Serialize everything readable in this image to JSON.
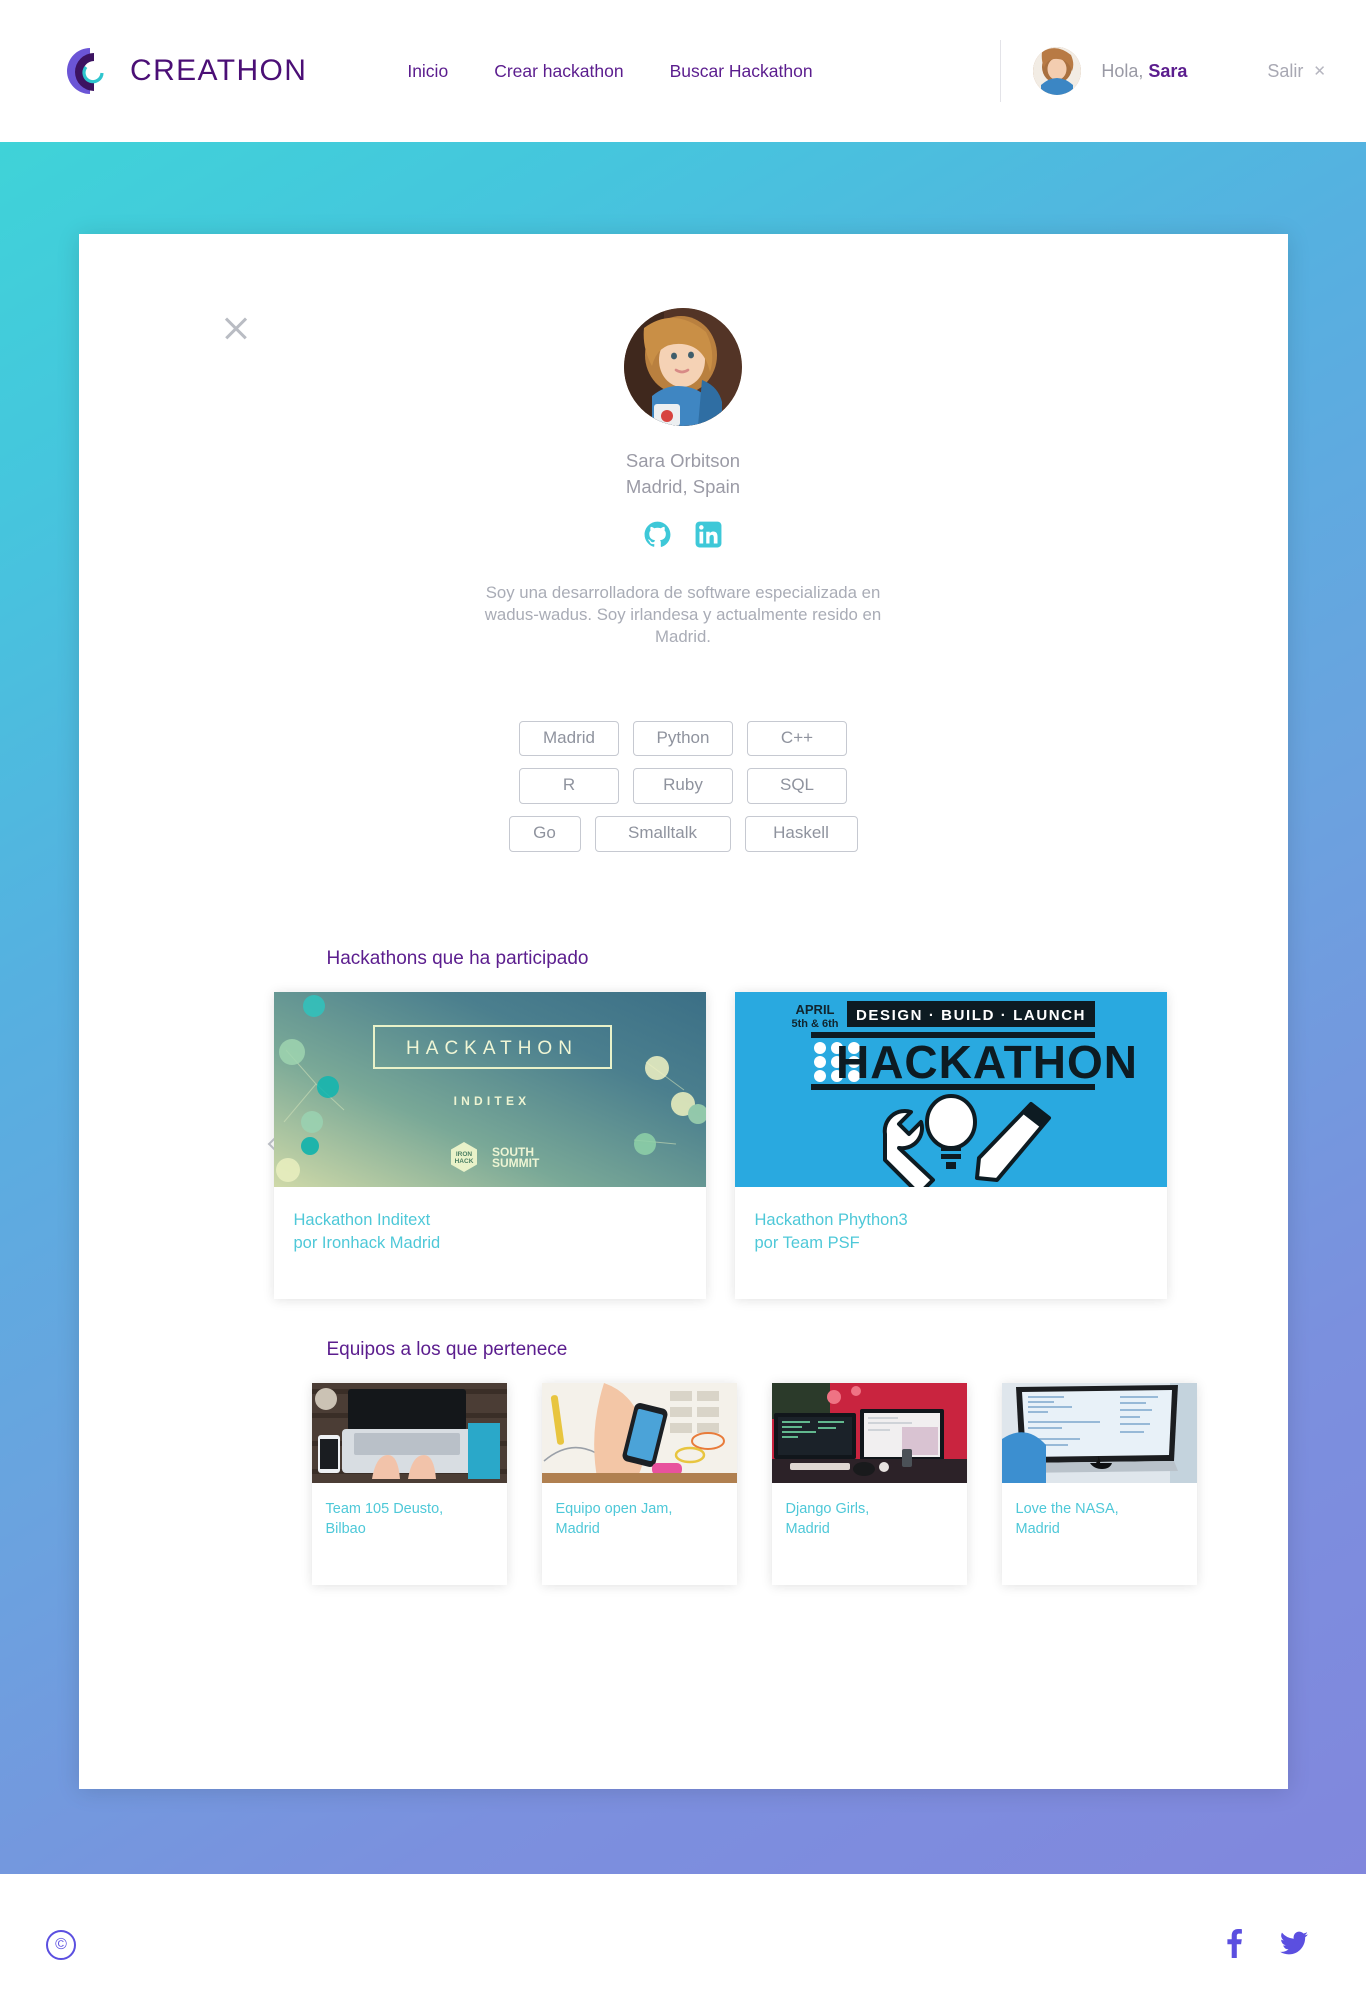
{
  "header": {
    "brand_name": "CREATHON",
    "brand_logo_icon": "creathon-c-logo-icon",
    "nav": [
      {
        "label": "Inicio",
        "name": "nav-inicio"
      },
      {
        "label": "Crear hackathon",
        "name": "nav-crear-hackathon"
      },
      {
        "label": "Buscar Hackathon",
        "name": "nav-buscar-hackathon"
      }
    ],
    "greeting_prefix": "Hola, ",
    "user_name": "Sara",
    "logout_label": "Salir",
    "logout_icon": "close-x-icon",
    "avatar_icon": "user-avatar"
  },
  "modal": {
    "close_icon": "close-icon",
    "profile": {
      "photo_icon": "profile-photo",
      "name": "Sara Orbitson",
      "location": "Madrid, Spain",
      "socials": [
        {
          "name": "github-icon",
          "label": "GitHub",
          "color": "#3ec8d8"
        },
        {
          "name": "linkedin-icon",
          "label": "LinkedIn",
          "color": "#3ec8d8"
        }
      ],
      "bio": "Soy una desarrolladora de software especializada en wadus-wadus. Soy irlandesa y actualmente resido en Madrid."
    },
    "tags": [
      {
        "label": "Madrid",
        "size": "w-md"
      },
      {
        "label": "Python",
        "size": "w-md"
      },
      {
        "label": "C++",
        "size": "w-md"
      },
      {
        "label": "R",
        "size": "w-md"
      },
      {
        "label": "Ruby",
        "size": "w-md"
      },
      {
        "label": "SQL",
        "size": "w-md"
      },
      {
        "label": "Go",
        "size": "w-sm"
      },
      {
        "label": "Smalltalk",
        "size": "w-xl"
      },
      {
        "label": "Haskell",
        "size": "w-lg"
      }
    ],
    "hackathons_section": {
      "title": "Hackathons que ha participado",
      "prev_icon": "chevron-left-icon",
      "next_icon": "chevron-right-icon",
      "cards": [
        {
          "title": "Hackathon Inditext",
          "subtitle": "por Ironhack Madrid",
          "banner_name": "hackathon-inditex-banner",
          "banner_text_main": "HACKATHON",
          "banner_text_sub": "INDITEX",
          "banner_logo_a": "IRON HACK",
          "banner_logo_b": "SOUTH SUMMIT"
        },
        {
          "title": "Hackathon Phython3",
          "subtitle": "por Team PSF",
          "banner_name": "hackathon-python3-banner",
          "banner_date": "APRIL 5th & 6th",
          "banner_tagline": "DESIGN · BUILD · LAUNCH",
          "banner_text_main": "HACKATHON"
        }
      ]
    },
    "teams_section": {
      "title": "Equipos a los que pertenece",
      "cards": [
        {
          "line1": "Team 105 Deusto,",
          "line2": "Bilbao",
          "photo_name": "team-photo-laptop-hands"
        },
        {
          "line1": "Equipo open Jam,",
          "line2": "Madrid",
          "photo_name": "team-photo-sketches-phone"
        },
        {
          "line1": "Django Girls,",
          "line2": "Madrid",
          "photo_name": "team-photo-dual-monitors"
        },
        {
          "line1": "Love the NASA,",
          "line2": "Madrid",
          "photo_name": "team-photo-imac-code"
        }
      ]
    }
  },
  "footer": {
    "copyright_symbol": "©",
    "socials": [
      {
        "name": "facebook-icon",
        "label": "Facebook"
      },
      {
        "name": "twitter-icon",
        "label": "Twitter"
      }
    ]
  },
  "colors": {
    "brand_purple": "#5b1d8e",
    "accent_teal": "#4ec8d8",
    "muted_gray": "#9b9ba6",
    "gradient_start": "#3fd3d8",
    "gradient_end": "#8187dd",
    "footer_icon": "#5b4fe0"
  }
}
